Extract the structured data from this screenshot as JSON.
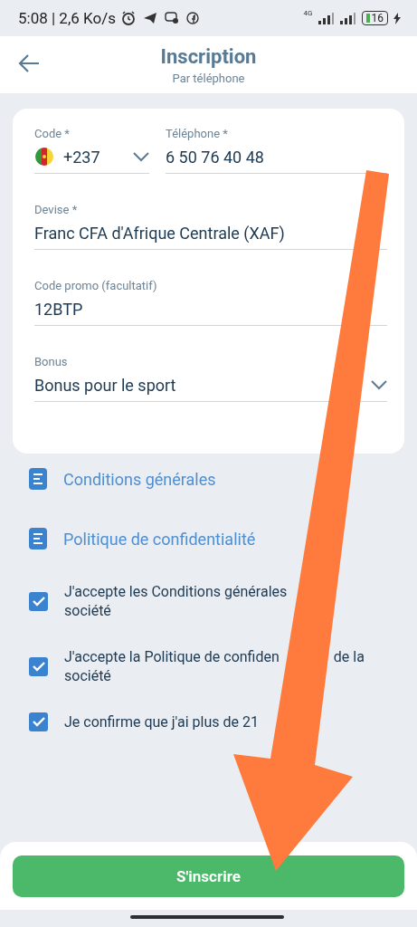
{
  "status_bar": {
    "time": "5:08 | 2,6 Ko/s",
    "network": "4G",
    "battery": "16"
  },
  "header": {
    "title": "Inscription",
    "subtitle": "Par téléphone"
  },
  "form": {
    "code": {
      "label": "Code *",
      "value": "+237"
    },
    "phone": {
      "label": "Téléphone *",
      "value": "6 50 76 40 48"
    },
    "fields": [
      {
        "label": "Devise *",
        "value": "Franc CFA d'Afrique Centrale (XAF)",
        "chevron": false
      },
      {
        "label": "Code promo (facultatif)",
        "value": "12BTP",
        "chevron": false
      },
      {
        "label": "Bonus",
        "value": "Bonus pour le sport",
        "chevron": true
      }
    ]
  },
  "documents": [
    "Conditions générales",
    "Politique de confidentialité"
  ],
  "agreements": [
    {
      "checked": true,
      "lines": [
        [
          "J'accepte les Conditions générales"
        ],
        [
          "société"
        ]
      ]
    },
    {
      "checked": true,
      "lines": [
        [
          "J'accepte la Politique de confiden",
          "de la"
        ],
        [
          "société"
        ]
      ]
    },
    {
      "checked": true,
      "lines": [
        [
          "Je confirme que j'ai plus de 21"
        ]
      ]
    }
  ],
  "submit": "S'inscrire",
  "annotation": {
    "kind": "arrow"
  }
}
